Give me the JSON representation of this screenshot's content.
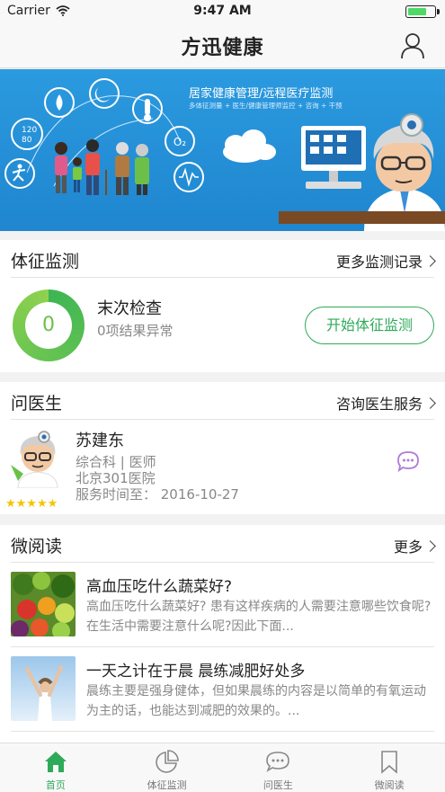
{
  "statusbar": {
    "carrier": "Carrier",
    "time": "9:47 AM",
    "battery_level": 0.75
  },
  "navbar": {
    "title": "方迅健康"
  },
  "banner": {
    "title": "居家健康管理/远程医疗监测",
    "subtitle": "多体征测量 + 医生/健康管理师监控 + 咨询 + 干预",
    "bp_text": "120\n80"
  },
  "vital": {
    "header": "体征监测",
    "more": "更多监测记录",
    "ring_value": "0",
    "title": "末次检查",
    "subtitle": "0项结果异常",
    "button": "开始体征监测"
  },
  "doctor": {
    "header": "问医生",
    "more": "咨询医生服务",
    "name": "苏建东",
    "dept": "综合科 | 医师",
    "hospital": "北京301医院",
    "service": "服务时间至：  2016-10-27",
    "rating": 5,
    "stars": "★★★★★"
  },
  "reading": {
    "header": "微阅读",
    "more": "更多",
    "articles": [
      {
        "title": "高血压吃什么蔬菜好?",
        "desc": "高血压吃什么蔬菜好?   患有这样疾病的人需要注意哪些饮食呢?在生活中需要注意什么呢?因此下面..."
      },
      {
        "title": "一天之计在于晨 晨练减肥好处多",
        "desc": "晨练主要是强身健体，但如果晨练的内容是以简单的有氧运动为主的话，也能达到减肥的效果的。..."
      }
    ]
  },
  "tabbar": {
    "tabs": [
      {
        "label": "首页",
        "active": true
      },
      {
        "label": "体征监测",
        "active": false
      },
      {
        "label": "问医生",
        "active": false
      },
      {
        "label": "微阅读",
        "active": false
      }
    ]
  },
  "colors": {
    "accent": "#2faa5a",
    "banner": "#1f86cf",
    "star": "#f5c400",
    "chat": "#b07ad6"
  }
}
